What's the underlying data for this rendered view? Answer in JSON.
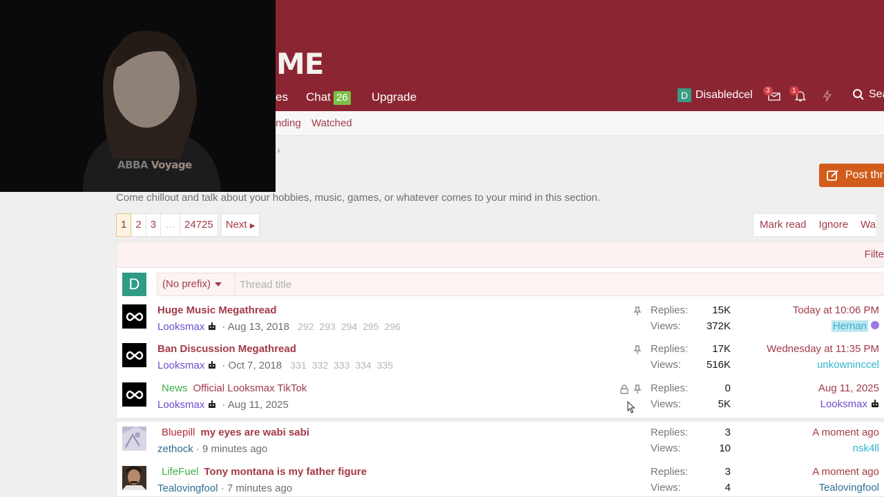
{
  "header": {
    "logo_text": "ME",
    "nav": {
      "partial_item": "es",
      "chat_label": "Chat",
      "chat_count": "26",
      "upgrade_label": "Upgrade"
    },
    "user": {
      "avatar_letter": "D",
      "name": "Disabledcel"
    },
    "inbox_badge": "3",
    "alerts_badge": "1",
    "search_label": "Sea"
  },
  "subnav": {
    "partial_item": "nding",
    "watched_label": "Watched"
  },
  "post_thread_label": "Post thr",
  "description": "Come chillout and talk about your hobbies, music, games, or whatever comes to your mind in this section.",
  "pagination": {
    "pages": [
      "1",
      "2",
      "3",
      "…",
      "24725"
    ],
    "next_label": "Next"
  },
  "actions": {
    "mark_read": "Mark read",
    "ignore": "Ignore",
    "watch_partial": "Wa"
  },
  "filter_label": "Filte",
  "quick_thread": {
    "avatar_letter": "D",
    "prefix_label": "(No prefix)",
    "title_placeholder": "Thread title"
  },
  "labels": {
    "replies": "Replies:",
    "views": "Views:",
    "separator": "·"
  },
  "threads": [
    {
      "title": "Huge Music Megathread",
      "prefix": "",
      "author": "Looksmax",
      "date": "Aug 13, 2018",
      "page_links": [
        "292",
        "293",
        "294",
        "295",
        "296"
      ],
      "replies": "15K",
      "views": "372K",
      "latest_date": "Today at 10:06 PM",
      "latest_user": "Hernan"
    },
    {
      "title": "Ban Discussion Megathread",
      "prefix": "",
      "author": "Looksmax",
      "date": "Oct 7, 2018",
      "page_links": [
        "331",
        "332",
        "333",
        "334",
        "335"
      ],
      "replies": "17K",
      "views": "516K",
      "latest_date": "Wednesday at 11:35 PM",
      "latest_user": "unkowninccel"
    },
    {
      "title": "Official Looksmax TikTok",
      "prefix": "News",
      "author": "Looksmax",
      "date": "Aug 11, 2025",
      "page_links": [],
      "replies": "0",
      "views": "5K",
      "latest_date": "Aug 11, 2025",
      "latest_user": "Looksmax"
    },
    {
      "title": "my eyes are wabi sabi",
      "prefix": "Bluepill",
      "author": "zethock",
      "date": "9 minutes ago",
      "page_links": [],
      "replies": "3",
      "views": "10",
      "latest_date": "A moment ago",
      "latest_user": "nsk4ll"
    },
    {
      "title": "Tony montana is my father figure",
      "prefix": "LifeFuel",
      "author": "Tealovingfool",
      "date": "7 minutes ago",
      "page_links": [],
      "replies": "3",
      "views": "4",
      "latest_date": "A moment ago",
      "latest_user": "Tealovingfool"
    }
  ],
  "webcam": {
    "shirt_text_a": "ABBA",
    "shirt_text_b": "Voyage"
  },
  "colors": {
    "header_bg": "#8c2532",
    "link": "#a23a48",
    "post_button": "#d25c1b",
    "chat_badge": "#7cc04a"
  }
}
